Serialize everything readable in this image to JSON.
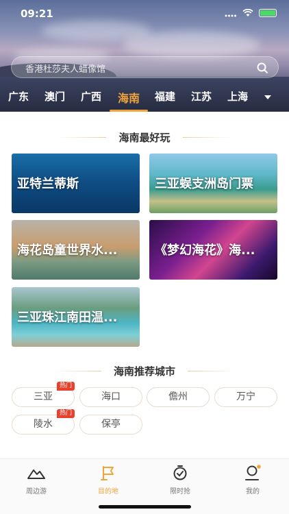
{
  "status": {
    "time": "09:21"
  },
  "search": {
    "placeholder": "香港杜莎夫人蜡像馆"
  },
  "tabs": [
    "广东",
    "澳门",
    "广西",
    "海南",
    "福建",
    "江苏",
    "上海"
  ],
  "active_tab": "海南",
  "section_fun": {
    "title": "海南最好玩"
  },
  "cards": [
    {
      "label": "亚特兰蒂斯"
    },
    {
      "label": "三亚蜈支洲岛门票"
    },
    {
      "label": "海花岛童世界水..."
    },
    {
      "label": "《梦幻海花》海..."
    },
    {
      "label": "三亚珠江南田温..."
    }
  ],
  "section_cities": {
    "title": "海南推荐城市"
  },
  "cities": [
    {
      "name": "三亚",
      "badge": "热门"
    },
    {
      "name": "海口",
      "badge": ""
    },
    {
      "name": "儋州",
      "badge": ""
    },
    {
      "name": "万宁",
      "badge": ""
    },
    {
      "name": "陵水",
      "badge": "热门"
    },
    {
      "name": "保亭",
      "badge": ""
    }
  ],
  "nav": [
    {
      "label": "周边游",
      "icon": "mountain-icon"
    },
    {
      "label": "目的地",
      "icon": "flag-icon"
    },
    {
      "label": "限时抢",
      "icon": "stopwatch-icon"
    },
    {
      "label": "我的",
      "icon": "user-icon"
    }
  ],
  "colors": {
    "accent": "#f0a43a",
    "hot": "#e8412c"
  }
}
